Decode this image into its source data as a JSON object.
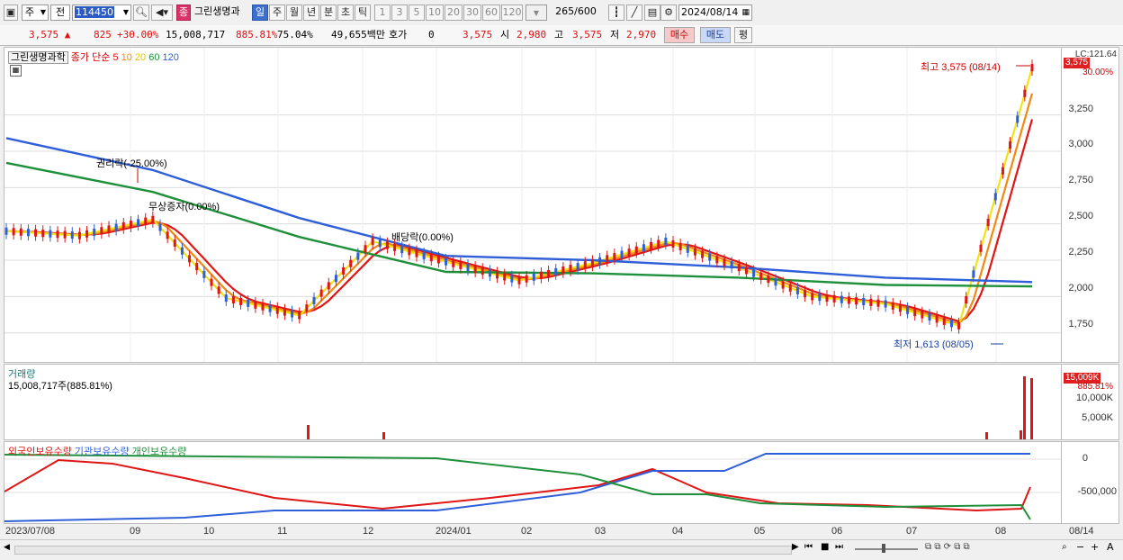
{
  "toolbar": {
    "market_label": "주",
    "prev_label": "전",
    "code": "114450",
    "stock_badge": "종",
    "stock_name": "그린생명과",
    "periods": [
      "일",
      "주",
      "월",
      "년",
      "분",
      "초",
      "틱"
    ],
    "active_period": "일",
    "minute_options": [
      "1",
      "3",
      "5",
      "10",
      "20",
      "30",
      "60",
      "120"
    ],
    "count_value": "265",
    "count_total": "/600",
    "date": "2024/08/14"
  },
  "quote": {
    "price": "3,575",
    "change": "825",
    "change_pct": "+30.00%",
    "volume": "15,008,717",
    "volume_ratio": "885.81%",
    "turnover": "75.04%",
    "amount": "49,655백만",
    "hoga_label": "호가",
    "hoga_value": "0",
    "last": "3,575",
    "open_label": "시",
    "open": "2,980",
    "high_label": "고",
    "high": "3,575",
    "low_label": "저",
    "low": "2,970",
    "buy_label": "매수",
    "sell_label": "매도",
    "avg_label": "평"
  },
  "price_pane": {
    "name": "그린생명과학",
    "legend_prefix": "종가 단순",
    "ma_periods": [
      "5",
      "10",
      "20",
      "60",
      "120"
    ],
    "ma_colors": [
      "#e01515",
      "#f08a12",
      "#f2e21a",
      "#1e8f3a",
      "#2f5fd8"
    ],
    "y_ticks": [
      "3,250",
      "3,000",
      "2,750",
      "2,500",
      "2,250",
      "2,000",
      "1,750"
    ],
    "top_label": "LC:121.64",
    "pct_label": "30.00%",
    "price_tag": "3,575",
    "high_note": "최고 3,575 (08/14)",
    "low_note": "최저 1,613 (08/05)",
    "event1": "권리락(-25.00%)",
    "event2": "무상증자(0.00%)",
    "event3": "배당락(0.00%)"
  },
  "volume_pane": {
    "title": "거래량",
    "info": "15,008,717주(885.81%)",
    "tag": "15,009K",
    "pct": "885.81%",
    "y_ticks": [
      "10,000K",
      "5,000K"
    ]
  },
  "holdings_pane": {
    "legend": [
      "외국인보유수량",
      "기관보유수량",
      "개인보유수량"
    ],
    "colors": [
      "#e01515",
      "#2f5fd8",
      "#1e8f3a"
    ],
    "y_ticks": [
      "0",
      "-500,000"
    ]
  },
  "x_axis": {
    "labels": [
      "2023/07/08",
      "09",
      "10",
      "11",
      "12",
      "2024/01",
      "02",
      "03",
      "04",
      "05",
      "06",
      "07",
      "08"
    ],
    "end_label": "08/14"
  },
  "chart_data": {
    "type": "line",
    "title": "그린생명과학",
    "series": [
      {
        "name": "종가 단순 5",
        "x": [
          "2023/07",
          "2023/08",
          "2023/09",
          "2023/10",
          "2023/11",
          "2023/12",
          "2024/01",
          "2024/02",
          "2024/03",
          "2024/04",
          "2024/05",
          "2024/06",
          "2024/07",
          "2024/08/05",
          "2024/08/14"
        ],
        "values": [
          2450,
          2420,
          2530,
          1990,
          1870,
          2380,
          2240,
          2110,
          2230,
          2380,
          2200,
          2000,
          1950,
          1800,
          3575
        ]
      },
      {
        "name": "120",
        "x": [
          "2023/07",
          "2023/09",
          "2023/11",
          "2024/01",
          "2024/03",
          "2024/05",
          "2024/07",
          "2024/08/14"
        ],
        "values": [
          3090,
          2870,
          2540,
          2280,
          2250,
          2200,
          2130,
          2100
        ]
      }
    ],
    "ylim": [
      1600,
      3650
    ],
    "high": {
      "value": 3575,
      "date": "08/14"
    },
    "low": {
      "value": 1613,
      "date": "08/05"
    }
  }
}
